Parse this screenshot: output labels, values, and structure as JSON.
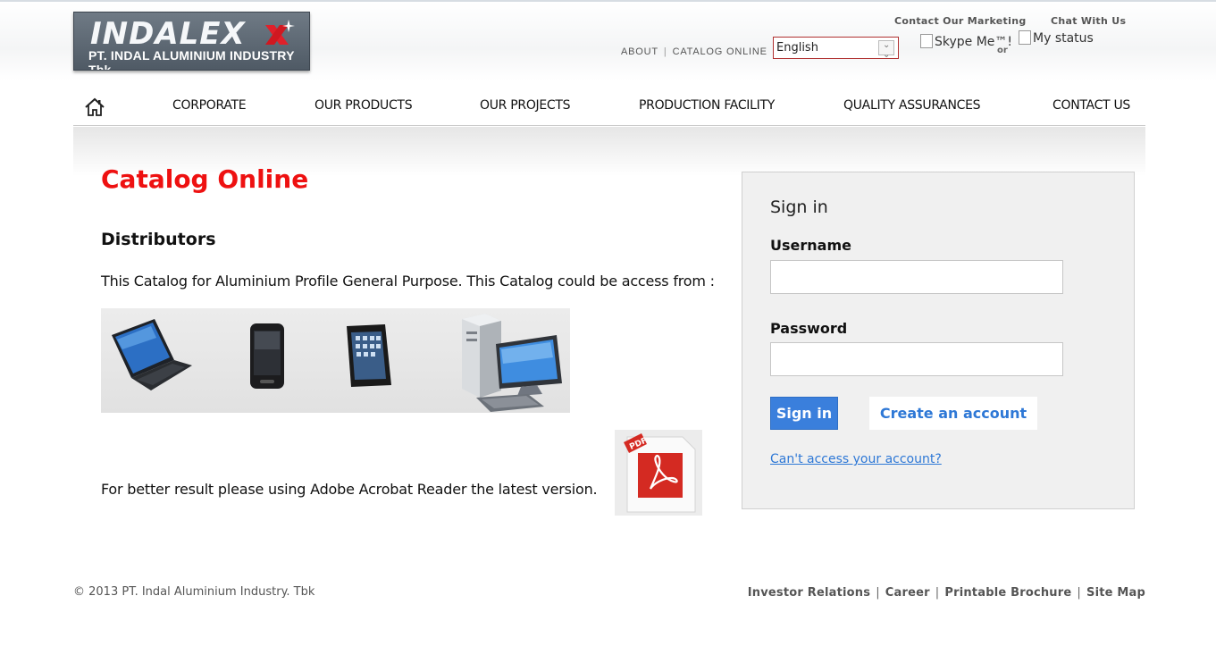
{
  "header": {
    "logo_word": "INDALEX",
    "logo_subtitle": "PT. INDAL ALUMINIUM INDUSTRY Tbk.",
    "top_links": [
      "ABOUT",
      "CATALOG ONLINE"
    ],
    "top_link_separator": "|",
    "language": "English",
    "contact_marketing": "Contact Our Marketing",
    "chat_with_us": "Chat With Us",
    "skype_alt": "Skype Me™!",
    "or_text": "or",
    "status_alt": "My status"
  },
  "nav": {
    "items": [
      "CORPORATE",
      "OUR PRODUCTS",
      "OUR PROJECTS",
      "PRODUCTION FACILITY",
      "QUALITY ASSURANCES",
      "CONTACT US"
    ]
  },
  "main": {
    "title": "Catalog Online",
    "section_title": "Distributors",
    "intro": "This Catalog for Aluminium Profile General Purpose. This Catalog could be access from :",
    "acrobat_note": "For better result please using Adobe Acrobat Reader the latest version.",
    "pdf_badge": "PDF"
  },
  "signin": {
    "title": "Sign in",
    "username_label": "Username",
    "username_value": "",
    "password_label": "Password",
    "password_value": "",
    "signin_button": "Sign in",
    "create_account_button": "Create an account",
    "cant_access_link": "Can't access your account?"
  },
  "footer": {
    "copyright": "© 2013 PT. Indal Aluminium Industry. Tbk",
    "links": [
      "Investor Relations",
      "Career",
      "Printable Brochure",
      "Site Map"
    ],
    "separator": "|"
  },
  "colors": {
    "title_red": "#ee1111",
    "link_blue": "#2e78d6",
    "button_blue": "#3a7fdc",
    "logo_gray": "#5a6570"
  }
}
